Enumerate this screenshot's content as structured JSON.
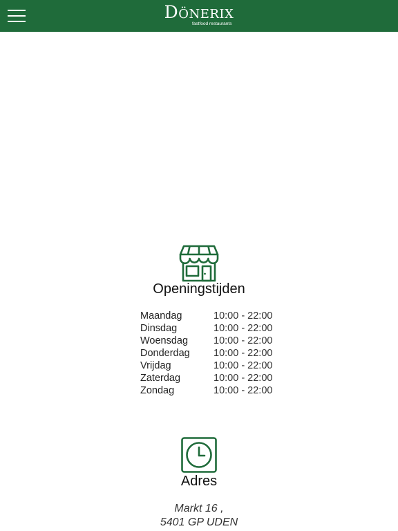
{
  "header": {
    "brand": "Dönerix",
    "tagline": "fastfood restaurants",
    "menu_icon": "hamburger-menu-icon",
    "background": "#1f6b3a"
  },
  "opening_hours": {
    "icon": "storefront-icon",
    "title": "Openingstijden",
    "rows": [
      {
        "day": "Maandag",
        "time": "10:00 - 22:00"
      },
      {
        "day": "Dinsdag",
        "time": "10:00 - 22:00"
      },
      {
        "day": "Woensdag",
        "time": "10:00 - 22:00"
      },
      {
        "day": "Donderdag",
        "time": "10:00 - 22:00"
      },
      {
        "day": "Vrijdag",
        "time": "10:00 - 22:00"
      },
      {
        "day": "Zaterdag",
        "time": "10:00 - 22:00"
      },
      {
        "day": "Zondag",
        "time": "10:00 - 22:00"
      }
    ]
  },
  "address": {
    "icon": "clock-icon",
    "title": "Adres",
    "line1": "Markt 16 ,",
    "line2": "5401 GP UDEN"
  },
  "colors": {
    "accent": "#1f6b3a"
  }
}
